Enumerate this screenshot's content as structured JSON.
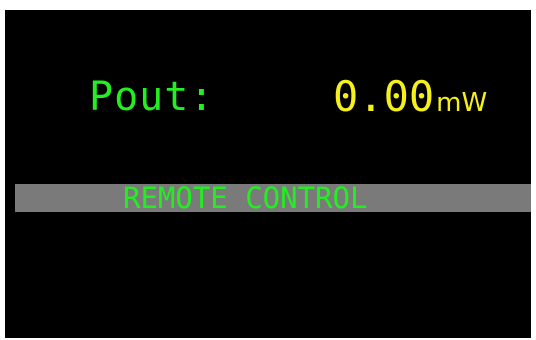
{
  "display": {
    "label": "Pout:",
    "value": "0.00",
    "unit": "mW",
    "status": "REMOTE CONTROL"
  },
  "colors": {
    "background": "#000000",
    "label": "#22ee22",
    "value": "#f5f01a",
    "status_bar": "#7a7a7a",
    "status_text": "#22ee22"
  }
}
